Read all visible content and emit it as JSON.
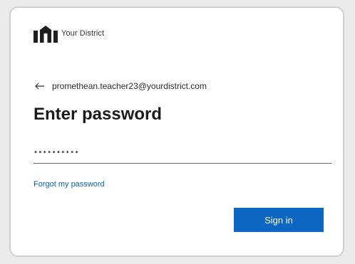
{
  "brand": {
    "name": "Your District",
    "logo_icon": "school-building-icon"
  },
  "identity": {
    "back_icon": "back-arrow-icon",
    "email": "promethean.teacher23@yourdistrict.com"
  },
  "title": "Enter password",
  "password_field": {
    "value": "••••••••••",
    "type": "password"
  },
  "links": {
    "forgot": "Forgot my password"
  },
  "buttons": {
    "sign_in": "Sign in"
  },
  "colors": {
    "primary_button": "#0c66c2",
    "link": "#0d63b3",
    "card_background": "#ffffff",
    "page_background": "#ebebeb"
  }
}
